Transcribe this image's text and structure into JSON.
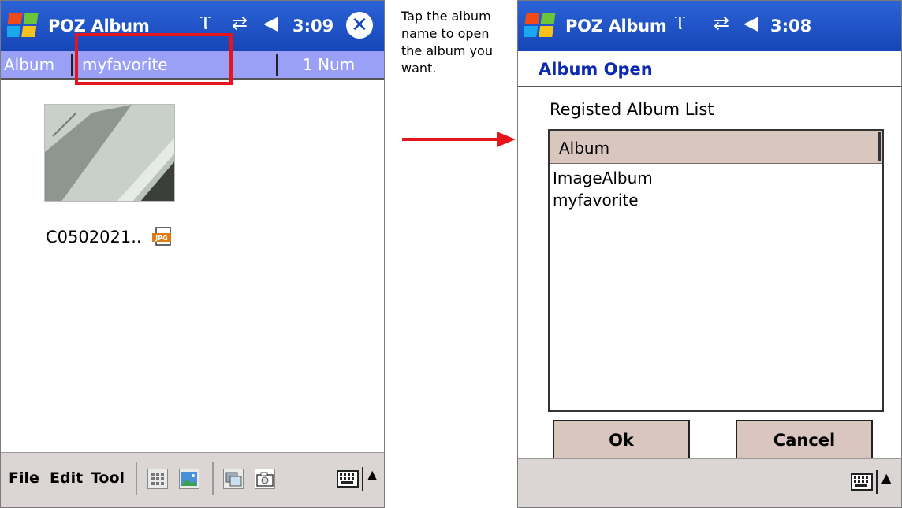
{
  "left_screen": {
    "title": "POZ Album",
    "clock": "3:09",
    "status_icons": [
      "antenna-icon",
      "sync-icon",
      "speaker-icon"
    ],
    "close_label": "✕",
    "album_bar": {
      "album_label": "Album",
      "album_name": "myfavorite",
      "count": "1 Num"
    },
    "thumbnail_caption": "C0502021..",
    "file_type_badge": "JPG",
    "menu": [
      "File",
      "Edit",
      "Tool"
    ]
  },
  "annotation": {
    "text": "Tap the album name to open the album you want."
  },
  "right_screen": {
    "title": "POZ Album",
    "clock": "3:08",
    "dialog_title": "Album Open",
    "list_label": "Registed Album List",
    "list_header": "Album",
    "albums": [
      "ImageAlbum",
      "myfavorite"
    ],
    "ok_label": "Ok",
    "cancel_label": "Cancel"
  },
  "colors": {
    "titlebar": "#1f53c8",
    "album_bar": "#9aa0f6",
    "highlight": "#e8141b",
    "dialog_title": "#0c2bb0",
    "button_face": "#d8c6bf",
    "command_bar": "#dbd6d3"
  }
}
